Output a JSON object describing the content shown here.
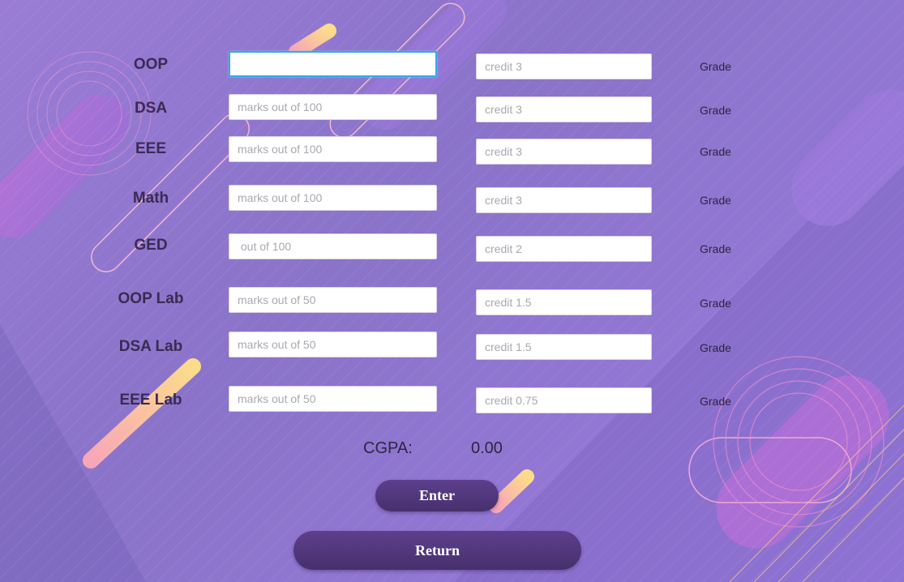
{
  "subjects": [
    {
      "name": "OOP",
      "marks_placeholder": "",
      "marks_value": "",
      "credit_placeholder": "credit 3",
      "grade": "Grade"
    },
    {
      "name": "DSA",
      "marks_placeholder": "marks out of 100",
      "marks_value": "",
      "credit_placeholder": "credit 3",
      "grade": "Grade"
    },
    {
      "name": "EEE",
      "marks_placeholder": "marks out of 100",
      "marks_value": "",
      "credit_placeholder": "credit 3",
      "grade": "Grade"
    },
    {
      "name": "Math",
      "marks_placeholder": "marks out of 100",
      "marks_value": "",
      "credit_placeholder": "credit 3",
      "grade": "Grade"
    },
    {
      "name": "GED",
      "marks_placeholder": " out of 100",
      "marks_value": "",
      "credit_placeholder": "credit 2",
      "grade": "Grade"
    },
    {
      "name": "OOP Lab",
      "marks_placeholder": "marks out of 50",
      "marks_value": "",
      "credit_placeholder": "credit 1.5",
      "grade": "Grade"
    },
    {
      "name": "DSA Lab",
      "marks_placeholder": "marks out of 50",
      "marks_value": "",
      "credit_placeholder": "credit 1.5",
      "grade": "Grade"
    },
    {
      "name": "EEE Lab",
      "marks_placeholder": "marks out of 50",
      "marks_value": "",
      "credit_placeholder": "credit 0.75",
      "grade": "Grade"
    }
  ],
  "cgpa": {
    "label": "CGPA:",
    "value": "0.00"
  },
  "buttons": {
    "enter": "Enter",
    "return": "Return"
  },
  "colors": {
    "accent": "#4f3579",
    "focus": "#38a8e8",
    "text": "#3a2b52"
  }
}
